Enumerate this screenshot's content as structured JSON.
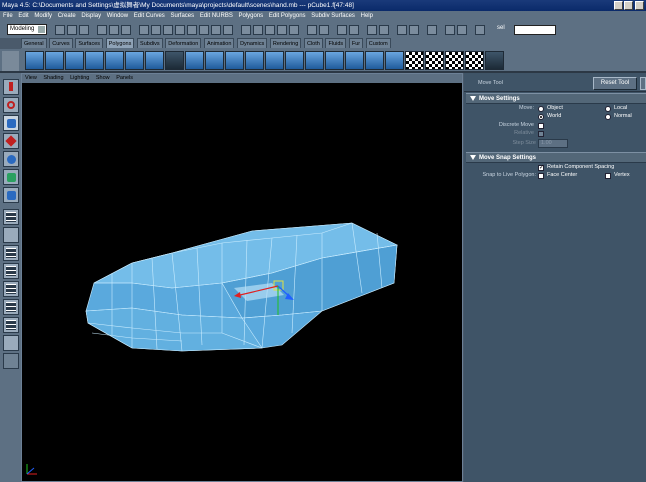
{
  "window": {
    "title": "Maya 4.5: C:\\Documents and Settings\\虚拟舞者\\My Documents\\maya\\projects\\default\\scenes\\hand.mb  ---  pCube1.f[47:48]"
  },
  "menubar": {
    "items": [
      "File",
      "Edit",
      "Modify",
      "Create",
      "Display",
      "Window",
      "Edit Curves",
      "Surfaces",
      "Edit NURBS",
      "Polygons",
      "Edit Polygons",
      "Subdiv Surfaces",
      "Help"
    ]
  },
  "statusline": {
    "mode": "Modeling",
    "sel_label": "sel"
  },
  "shelf": {
    "tabs": [
      "General",
      "Curves",
      "Surfaces",
      "Polygons",
      "Subdivs",
      "Deformation",
      "Animation",
      "Dynamics",
      "Rendering",
      "Cloth",
      "Fluids",
      "Fur",
      "Custom"
    ],
    "active_tab": "Polygons"
  },
  "panel": {
    "menu": [
      "View",
      "Shading",
      "Lighting",
      "Show",
      "Panels"
    ]
  },
  "attribute_editor": {
    "tool_title": "Move Tool",
    "reset_label": "Reset Tool",
    "move_settings": {
      "header": "Move Settings",
      "move_label": "Move:",
      "options": [
        "Object",
        "Local",
        "World",
        "Normal"
      ],
      "selected": "World",
      "discrete_label": "Discrete Move",
      "relative_label": "Relative",
      "step_label": "Step Size",
      "step_value": "1.00"
    },
    "snap_settings": {
      "header": "Move Snap Settings",
      "retain_label": "Retain Component Spacing",
      "retain_checked": true,
      "snap_live_label": "Snap to Live Polygon:",
      "face_center_label": "Face Center",
      "vertex_label": "Vertex"
    }
  },
  "icons": {
    "toolbox": [
      "select-tool-icon",
      "lasso-tool-icon",
      "paint-select-icon",
      "move-tool-icon",
      "rotate-tool-icon",
      "scale-tool-icon",
      "manipulator-icon",
      "last-tool-icon",
      "single-view-icon",
      "four-view-icon",
      "layout-icon",
      "outliner-icon",
      "graph-icon",
      "hypershade-icon",
      "script-icon",
      "list-icon"
    ],
    "viewport_axis": "axis-gizmo-icon"
  },
  "colors": {
    "mesh_fill": "#5fb2e6",
    "mesh_wire": "#bfe6ff",
    "ui_bg": "#5d7083",
    "ae_bg": "#3f5467"
  }
}
